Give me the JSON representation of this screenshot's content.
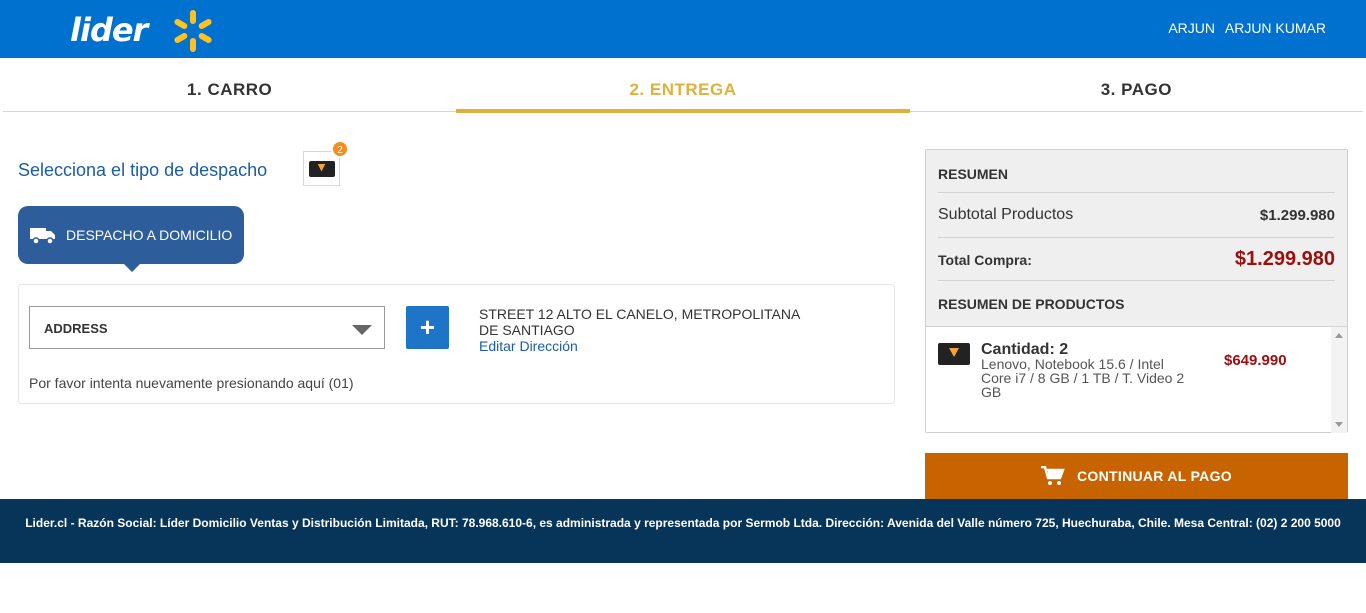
{
  "header": {
    "logo_text": "lider",
    "user_first": "ARJUN",
    "user_full": "ARJUN KUMAR"
  },
  "steps": [
    {
      "label": "1. CARRO",
      "active": false
    },
    {
      "label": "2. ENTREGA",
      "active": true
    },
    {
      "label": "3. PAGO",
      "active": false
    }
  ],
  "delivery": {
    "title": "Selecciona el tipo de despacho",
    "cart_badge": "2",
    "option_label": "DESPACHO A DOMICILIO"
  },
  "address": {
    "select_value": "ADDRESS",
    "add_label": "+",
    "address_text": "STREET 12 ALTO EL CANELO, METROPOLITANA DE SANTIAGO",
    "edit_label": "Editar Dirección",
    "retry_text": "Por favor intenta nuevamente presionando aquí (01)"
  },
  "summary": {
    "title": "RESUMEN",
    "subtotal_label": "Subtotal Productos",
    "subtotal_value": "$1.299.980",
    "total_label": "Total Compra:",
    "total_value": "$1.299.980",
    "products_title": "RESUMEN DE PRODUCTOS",
    "product": {
      "qty": "Cantidad: 2",
      "desc": "Lenovo, Notebook 15.6 / Intel Core i7 / 8 GB / 1 TB / T. Video 2 GB",
      "price": "$649.990"
    }
  },
  "continue_label": "CONTINUAR AL PAGO",
  "footer_text": "Lider.cl - Razón Social: Líder Domicilio Ventas y Distribución Limitada, RUT: 78.968.610-6, es administrada y representada por Sermob Ltda. Dirección: Avenida del Valle número 725, Huechuraba, Chile. Mesa Central: (02) 2 200 5000",
  "colors": {
    "brand_blue": "#0071ce",
    "active_step": "#e1b03a",
    "price_red": "#9b0f0f",
    "cta_orange": "#c86400",
    "footer_navy": "#07355a"
  }
}
